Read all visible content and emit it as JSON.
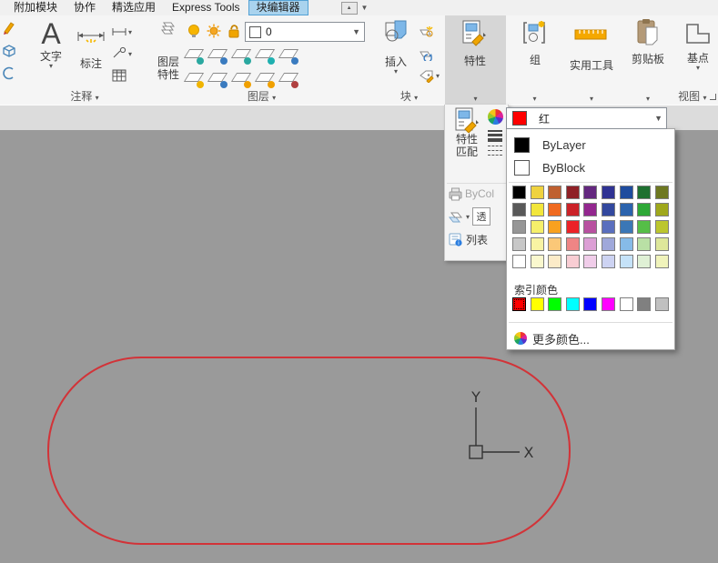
{
  "tabs": {
    "items": [
      "附加模块",
      "协作",
      "精选应用",
      "Express Tools",
      "块编辑器"
    ],
    "active_index": 4
  },
  "ribbon": {
    "annotation_panel": {
      "label": "注释",
      "text_button": "文字",
      "dim_button": "标注"
    },
    "layer_panel": {
      "label": "图层",
      "properties_button_line1": "图层",
      "properties_button_line2": "特性",
      "layer_combo_value": "0"
    },
    "block_panel": {
      "label": "块",
      "insert_button": "插入"
    },
    "properties_panel": {
      "button": "特性"
    },
    "group_panel": {
      "button": "组"
    },
    "utilities_panel": {
      "button": "实用工具"
    },
    "clipboard_panel": {
      "button": "剪贴板"
    },
    "view_panel": {
      "label": "视图",
      "base_button": "基点"
    }
  },
  "flyout": {
    "match_button_line1": "特性",
    "match_button_line2": "匹配",
    "plot_style_value": "ByCol",
    "transparency_label": "透",
    "list_button": "列表"
  },
  "color_dropdown": {
    "selected_name": "红",
    "selected_color": "#FF0000",
    "bylayer_label": "ByLayer",
    "bylayer_color": "#000000",
    "byblock_label": "ByBlock",
    "byblock_color": "#FFFFFF",
    "grid_rows": [
      [
        "#000000",
        "#EFD23F",
        "#BF6030",
        "#8F2026",
        "#64287F",
        "#2F3293",
        "#1E4C9E",
        "#1E7030",
        "#6E7821"
      ],
      [
        "#595959",
        "#F2E63B",
        "#F06A20",
        "#CB2228",
        "#93278F",
        "#32489E",
        "#2B63AD",
        "#2EA836",
        "#9FA81C"
      ],
      [
        "#969696",
        "#F5EF6A",
        "#F9A11F",
        "#EC2227",
        "#B851A0",
        "#5A6FBE",
        "#3B77B6",
        "#55BE47",
        "#BCC62E"
      ],
      [
        "#C7C7C7",
        "#F8F3A3",
        "#FBC878",
        "#EF8585",
        "#DC9FD5",
        "#9FA8DA",
        "#86BBE8",
        "#B9E0A5",
        "#DEE79A"
      ],
      [
        "#FFFFFF",
        "#FAF8CE",
        "#FCEBC8",
        "#F8CDD3",
        "#F0CDE9",
        "#CDD3F2",
        "#C5E2F8",
        "#DFF0D5",
        "#F0F3BB"
      ]
    ],
    "index_section_label": "索引颜色",
    "index_colors": [
      "#FF0000",
      "#FFFF00",
      "#00FF00",
      "#00FFFF",
      "#0000FF",
      "#FF00FF",
      "#FFFFFF",
      "#808080",
      "#C0C0C0"
    ],
    "selected_index": 0,
    "more_colors_label": "更多颜色..."
  },
  "canvas": {
    "shape_stroke": "#D23338",
    "ucs_x_label": "X",
    "ucs_y_label": "Y"
  }
}
